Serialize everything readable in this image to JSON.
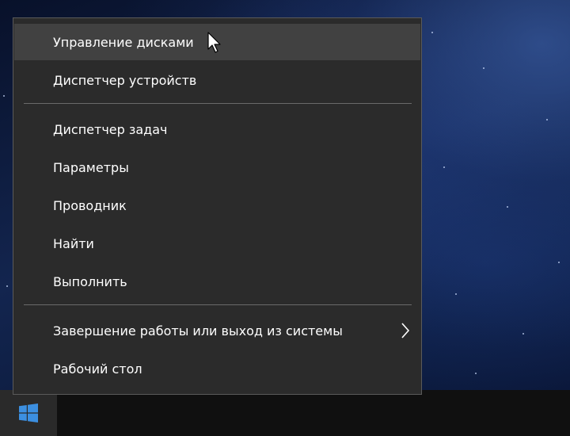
{
  "menu": {
    "items": [
      {
        "label": "Управление дисками",
        "hovered": true
      },
      {
        "label": "Диспетчер устройств"
      },
      {
        "label": "Диспетчер задач"
      },
      {
        "label": "Параметры"
      },
      {
        "label": "Проводник"
      },
      {
        "label": "Найти"
      },
      {
        "label": "Выполнить"
      },
      {
        "label": "Завершение работы или выход из системы",
        "has_submenu": true
      },
      {
        "label": "Рабочий стол"
      }
    ]
  },
  "taskbar": {
    "start_icon": "windows-logo-icon",
    "accent_color": "#3c8fe0"
  },
  "colors": {
    "menu_background": "#2b2b2b",
    "menu_hover": "#414141",
    "menu_text": "#ffffff",
    "separator": "#6a6a6a"
  }
}
